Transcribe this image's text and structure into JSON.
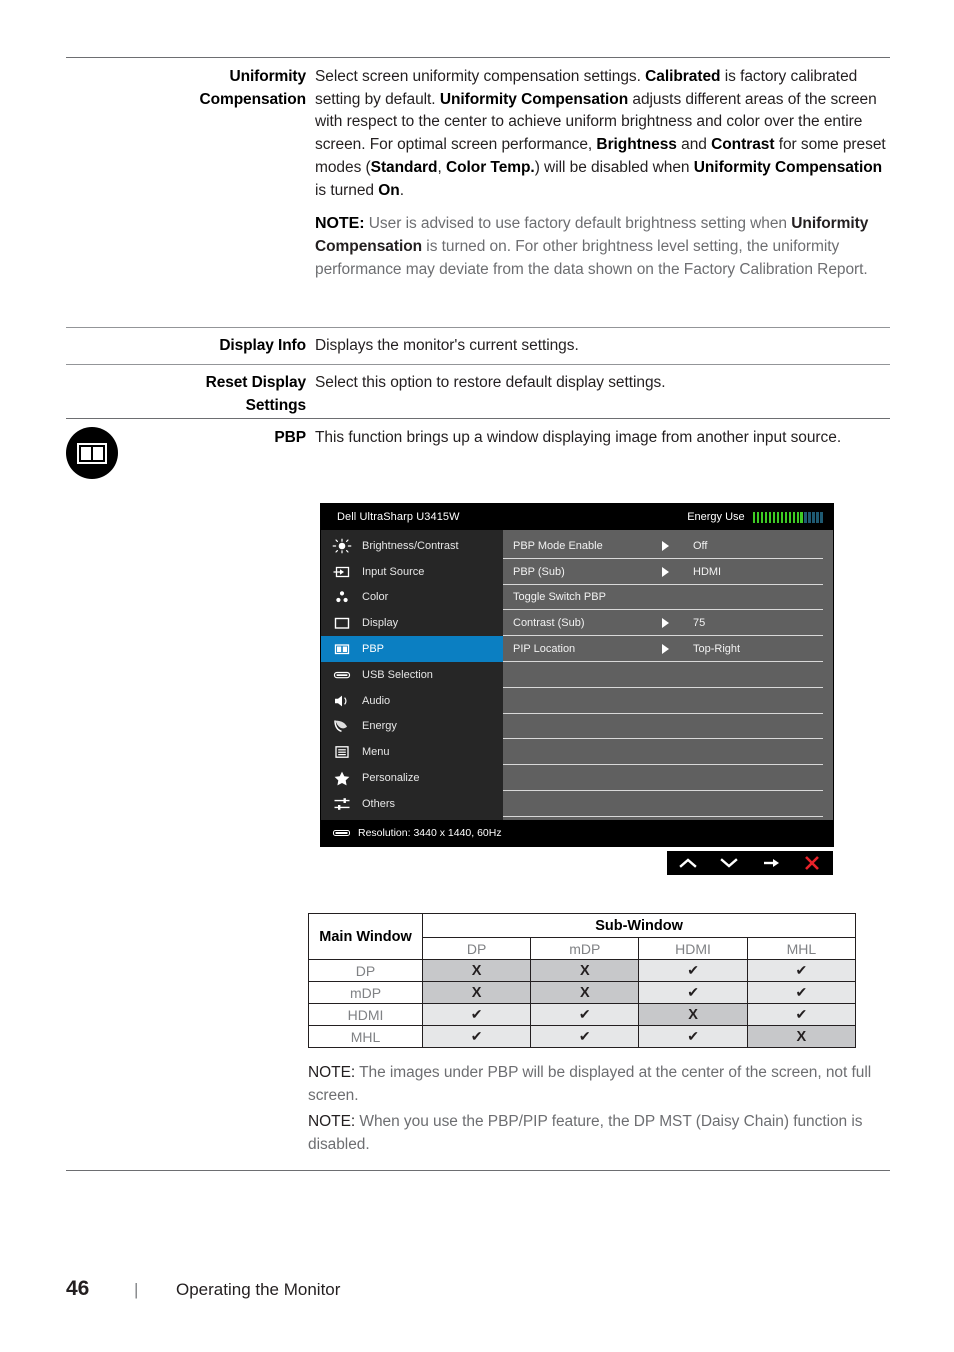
{
  "doc": {
    "rows": [
      {
        "term": "Uniformity Compensation",
        "desc_html": "Select screen uniformity compensation settings. <b>Calibrated</b> is factory calibrated setting by default. <b>Uniformity Compensation</b> adjusts different areas of the screen with respect to the center to achieve uniform brightness and color over the entire screen. For optimal screen performance, <b>Brightness</b> and <b>Contrast</b> for some preset modes (<b>Standard</b>, <b>Color Temp.</b>) will be disabled when <b>Uniformity Compensation</b> is turned <b>On</b>.",
        "note_label": "NOTE:",
        "note_html": " User is advised to use factory default brightness setting when <b>Uniformity Compensation</b> is turned on. For other brightness level setting, the uniformity performance may deviate from the data shown on the Factory Calibration Report."
      },
      {
        "term": "Display Info",
        "desc_html": "Displays the monitor's current settings."
      },
      {
        "term": "Reset Display Settings",
        "desc_html": "Select this option to restore default display settings."
      },
      {
        "term": "PBP",
        "desc_html": "This function brings up a window displaying image from another input source."
      }
    ]
  },
  "osd": {
    "title": "Dell UltraSharp U3415W",
    "energy_label": "Energy Use",
    "energy_bars_on": 13,
    "energy_bars_off": 5,
    "nav_items": [
      {
        "label": "Brightness/Contrast",
        "icon": "brightness-contrast-icon",
        "active": false
      },
      {
        "label": "Input Source",
        "icon": "input-source-icon",
        "active": false
      },
      {
        "label": "Color",
        "icon": "color-icon",
        "active": false
      },
      {
        "label": "Display",
        "icon": "display-icon",
        "active": false
      },
      {
        "label": "PBP",
        "icon": "pbp-icon",
        "active": true
      },
      {
        "label": "USB Selection",
        "icon": "usb-selection-icon",
        "active": false
      },
      {
        "label": "Audio",
        "icon": "audio-icon",
        "active": false
      },
      {
        "label": "Energy",
        "icon": "energy-icon",
        "active": false
      },
      {
        "label": "Menu",
        "icon": "menu-icon",
        "active": false
      },
      {
        "label": "Personalize",
        "icon": "personalize-star-icon",
        "active": false
      },
      {
        "label": "Others",
        "icon": "others-sliders-icon",
        "active": false
      }
    ],
    "options": [
      {
        "label": "PBP Mode Enable",
        "arrow": true,
        "value": "Off"
      },
      {
        "label": "PBP (Sub)",
        "arrow": true,
        "value": "HDMI"
      },
      {
        "label": "Toggle Switch PBP",
        "arrow": false,
        "value": ""
      },
      {
        "label": "Contrast (Sub)",
        "arrow": true,
        "value": "75"
      },
      {
        "label": "PIP Location",
        "arrow": true,
        "value": "Top-Right"
      },
      {
        "label": "",
        "arrow": false,
        "value": ""
      },
      {
        "label": "",
        "arrow": false,
        "value": ""
      },
      {
        "label": "",
        "arrow": false,
        "value": ""
      },
      {
        "label": "",
        "arrow": false,
        "value": ""
      },
      {
        "label": "",
        "arrow": false,
        "value": ""
      },
      {
        "label": "",
        "arrow": false,
        "value": ""
      }
    ],
    "resolution": "Resolution: 3440 x 1440, 60Hz",
    "keys": [
      "up-arrow-icon",
      "down-arrow-icon",
      "right-arrow-icon",
      "close-x-icon"
    ],
    "colors": {
      "highlight": "#0b7fc2",
      "nav_bg": "#262626",
      "content_bg": "#606060",
      "energy_on": "#3fcc24",
      "energy_off": "#1f5a72",
      "close_red": "#e8232a"
    }
  },
  "matrix": {
    "main_header": "Main Window",
    "sub_header": "Sub-Window",
    "sub_columns": [
      "DP",
      "mDP",
      "HDMI",
      "MHL"
    ],
    "rows": [
      {
        "main": "DP",
        "cells": [
          "X",
          "X",
          "✔",
          "✔"
        ]
      },
      {
        "main": "mDP",
        "cells": [
          "X",
          "X",
          "✔",
          "✔"
        ]
      },
      {
        "main": "HDMI",
        "cells": [
          "✔",
          "✔",
          "X",
          "✔"
        ]
      },
      {
        "main": "MHL",
        "cells": [
          "✔",
          "✔",
          "✔",
          "X"
        ]
      }
    ]
  },
  "notes_bottom": [
    {
      "label": "NOTE:",
      "text": " The images under PBP will be displayed at the center of the screen, not full screen."
    },
    {
      "label": "NOTE:",
      "text": " When you use the PBP/PIP feature, the DP MST (Daisy Chain) function is disabled."
    }
  ],
  "footer": {
    "page_number": "46",
    "separator": "|",
    "title": "Operating the Monitor"
  }
}
